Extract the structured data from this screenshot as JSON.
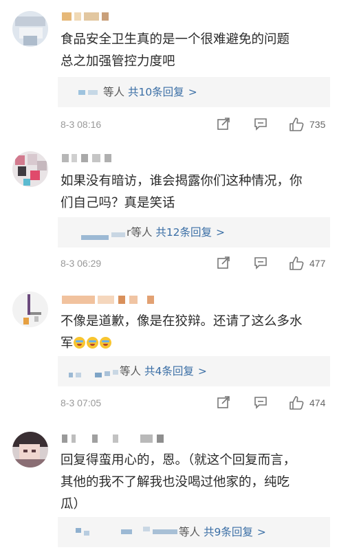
{
  "comments": [
    {
      "username": "",
      "text_lines": [
        "食品安全卫生真的是一个很难避免的问题",
        "总之加强管控力度吧"
      ],
      "reply_summary": {
        "suffix": "等人",
        "count": "共10条回复",
        "chevron": ">"
      },
      "time": "8-3 08:16",
      "likes": "735"
    },
    {
      "username": "",
      "text_lines": [
        "如果没有暗访，谁会揭露你们这种情况，你",
        "们自己吗？真是笑话"
      ],
      "reply_summary": {
        "suffix": "r等人",
        "count": "共12条回复",
        "chevron": ">"
      },
      "time": "8-3 06:29",
      "likes": "477"
    },
    {
      "username": "",
      "text_lines": [
        "不像是道歉，像是在狡辩。还请了这么多水",
        "军"
      ],
      "emoji_count": 3,
      "reply_summary": {
        "suffix": "等人",
        "count": "共4条回复",
        "chevron": ">"
      },
      "time": "8-3 07:05",
      "likes": "474"
    },
    {
      "username": "",
      "text_lines": [
        "回复得蛮用心的，恩。（就这个回复而言，",
        "其他的我不了解我也没喝过他家的，纯吃",
        "瓜）"
      ],
      "reply_summary": {
        "suffix": "等人",
        "count": "共9条回复",
        "chevron": ">"
      },
      "time": "",
      "likes": ""
    }
  ],
  "icons": {
    "share": "share-icon",
    "comment": "comment-icon",
    "like": "thumbs-up-icon"
  },
  "colors": {
    "link": "#3a6ea5",
    "meta": "#999999",
    "reply_bg": "#f5f5f5"
  }
}
